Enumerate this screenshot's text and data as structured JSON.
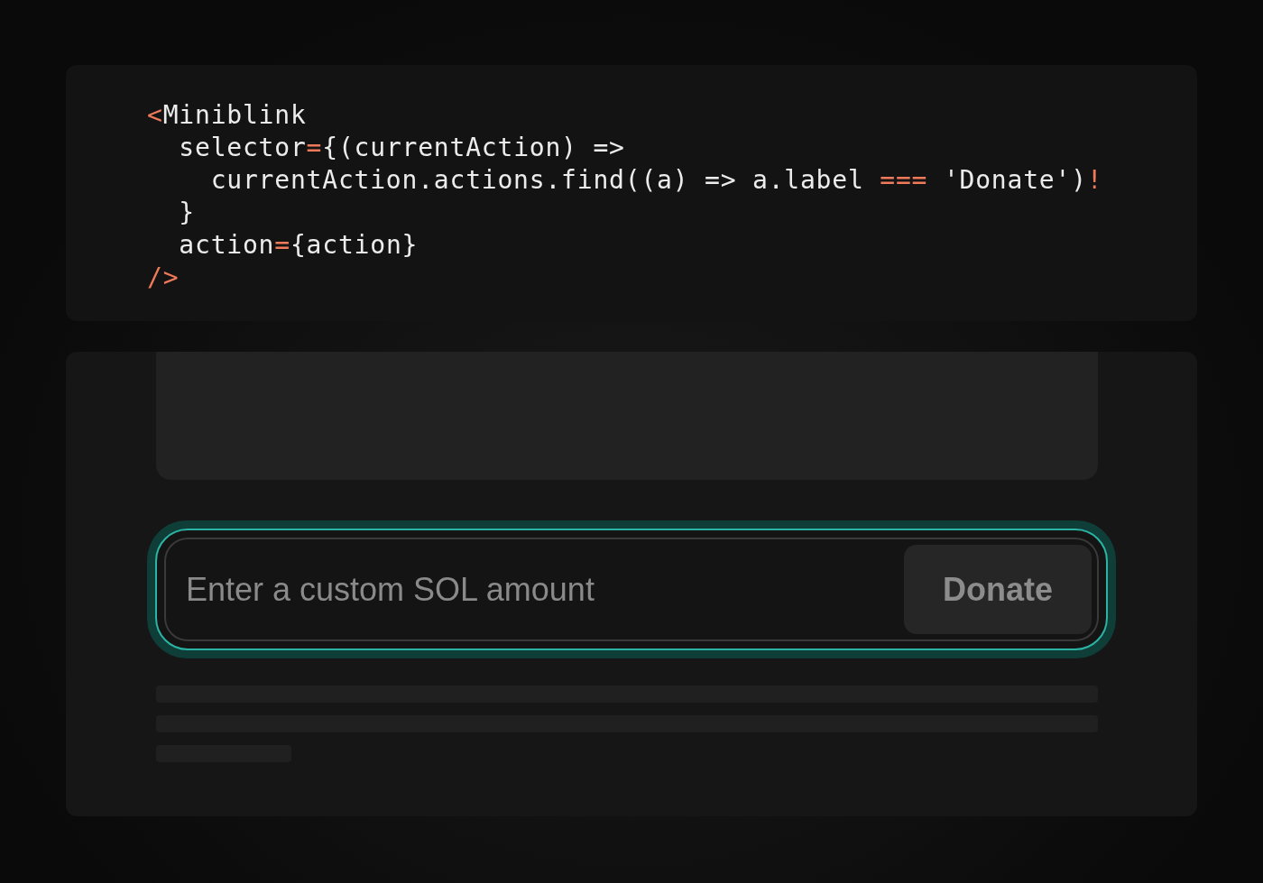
{
  "code": {
    "lines": [
      {
        "tokens": [
          {
            "text": "<",
            "kind": "operator"
          },
          {
            "text": "Miniblink",
            "kind": "plain"
          }
        ]
      },
      {
        "tokens": [
          {
            "text": "  selector",
            "kind": "plain"
          },
          {
            "text": "=",
            "kind": "operator"
          },
          {
            "text": "{(currentAction) =>",
            "kind": "plain"
          }
        ]
      },
      {
        "tokens": [
          {
            "text": "    currentAction.actions.find((a) => a.label ",
            "kind": "plain"
          },
          {
            "text": "===",
            "kind": "operator"
          },
          {
            "text": " 'Donate')",
            "kind": "plain"
          },
          {
            "text": "!",
            "kind": "operator"
          }
        ]
      },
      {
        "tokens": [
          {
            "text": "  }",
            "kind": "plain"
          }
        ]
      },
      {
        "tokens": [
          {
            "text": "  action",
            "kind": "plain"
          },
          {
            "text": "=",
            "kind": "operator"
          },
          {
            "text": "{action}",
            "kind": "plain"
          }
        ]
      },
      {
        "tokens": [
          {
            "text": "/>",
            "kind": "operator"
          }
        ]
      }
    ]
  },
  "preview": {
    "input": {
      "placeholder": "Enter a custom SOL amount"
    },
    "button": "Donate"
  }
}
